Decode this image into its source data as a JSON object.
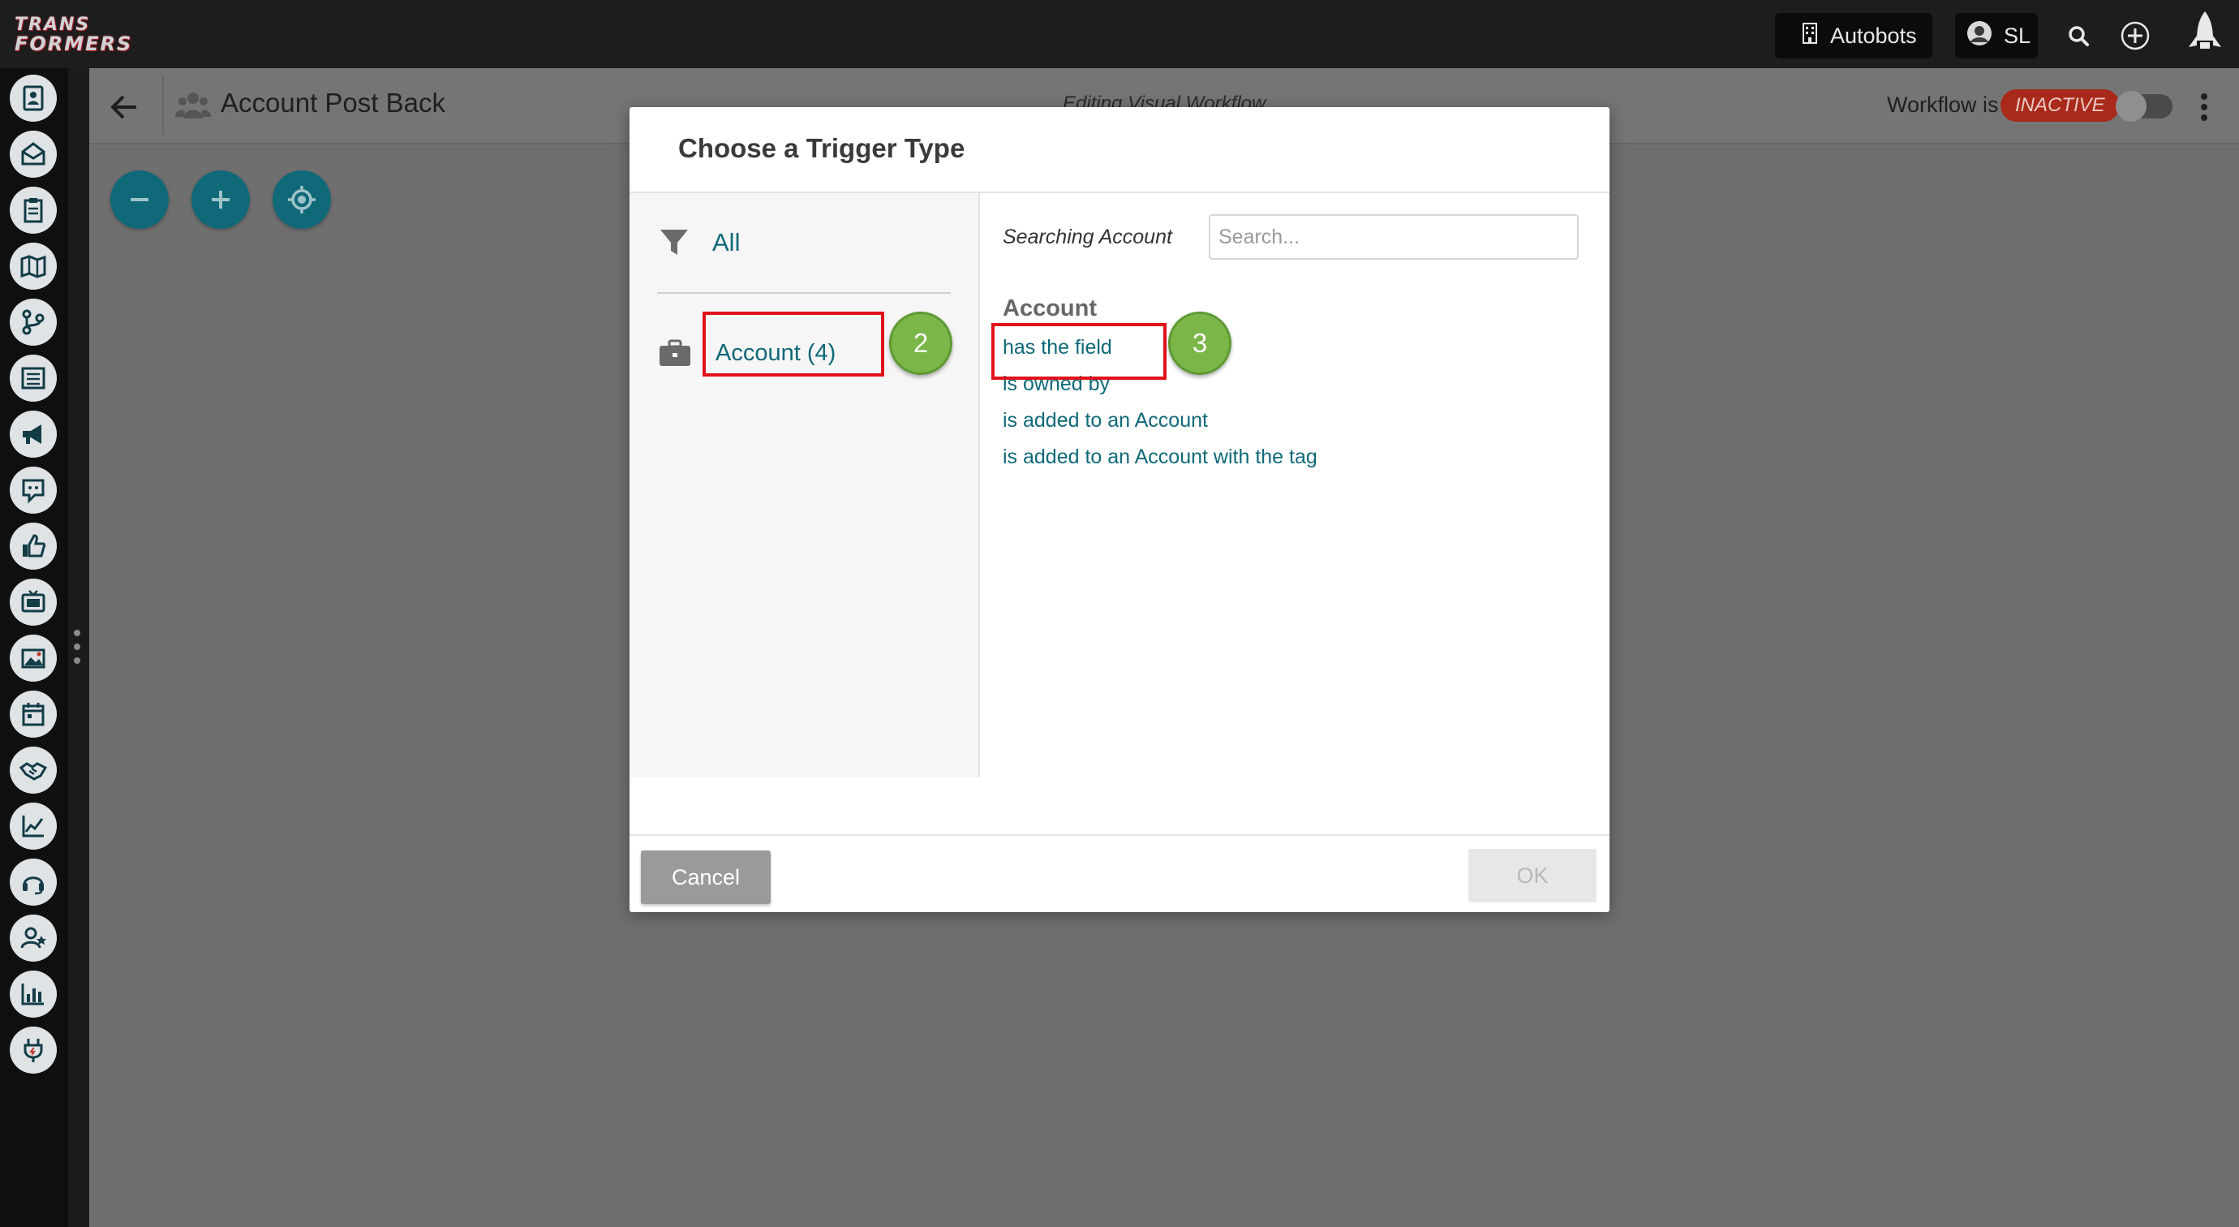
{
  "topbar": {
    "logo_line1": "TRANS",
    "logo_line2": "FORMERS",
    "org_label": "Autobots",
    "user_initials": "SL"
  },
  "header": {
    "title": "Account Post Back",
    "center_label": "Editing Visual Workflow",
    "workflow_label": "Workflow is",
    "workflow_status": "INACTIVE"
  },
  "modal": {
    "title": "Choose a Trigger Type",
    "categories": [
      {
        "label": "All"
      },
      {
        "label": "Account (4)"
      }
    ],
    "search": {
      "label": "Searching Account",
      "placeholder": "Search..."
    },
    "section_title": "Account",
    "options": [
      "has the field",
      "is owned by",
      "is added to an Account",
      "is added to an Account with the tag"
    ],
    "cancel_label": "Cancel",
    "ok_label": "OK"
  },
  "annotations": {
    "step_2": "2",
    "step_3": "3"
  },
  "colors": {
    "accent": "#0f6978",
    "inactive_badge": "#a9291b",
    "highlight": "#e0121b",
    "step_marker": "#7ab648"
  },
  "sidebar_icons": [
    "contact-card-icon",
    "inbox-icon",
    "clipboard-icon",
    "map-icon",
    "branch-icon",
    "list-icon",
    "megaphone-icon",
    "chat-icon",
    "thumbs-up-icon",
    "tv-icon",
    "image-icon",
    "calendar-icon",
    "handshake-icon",
    "trend-chart-icon",
    "headset-icon",
    "user-star-icon",
    "bar-chart-icon",
    "plug-icon"
  ]
}
